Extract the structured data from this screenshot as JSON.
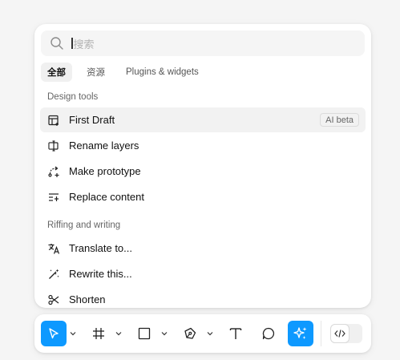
{
  "search": {
    "placeholder": "搜索"
  },
  "tabs": [
    {
      "label": "全部",
      "active": true
    },
    {
      "label": "资源",
      "active": false
    },
    {
      "label": "Plugins & widgets",
      "active": false
    }
  ],
  "sections": [
    {
      "title": "Design tools",
      "items": [
        {
          "label": "First Draft",
          "icon": "layout-icon",
          "badge": "AI beta",
          "selected": true
        },
        {
          "label": "Rename layers",
          "icon": "rename-icon"
        },
        {
          "label": "Make prototype",
          "icon": "prototype-icon"
        },
        {
          "label": "Replace content",
          "icon": "replace-content-icon"
        }
      ]
    },
    {
      "title": "Riffing and writing",
      "items": [
        {
          "label": "Translate to...",
          "icon": "translate-icon"
        },
        {
          "label": "Rewrite this...",
          "icon": "magic-wand-icon"
        },
        {
          "label": "Shorten",
          "icon": "shorten-icon"
        }
      ]
    }
  ],
  "toolbar": {
    "tools": [
      {
        "name": "move-tool",
        "icon": "cursor-icon",
        "active": true
      },
      {
        "name": "frame-tool",
        "icon": "frame-icon"
      },
      {
        "name": "shape-tool",
        "icon": "rectangle-icon"
      },
      {
        "name": "pen-tool",
        "icon": "pen-icon"
      },
      {
        "name": "text-tool",
        "icon": "text-icon"
      },
      {
        "name": "comment-tool",
        "icon": "comment-icon"
      },
      {
        "name": "ai-tool",
        "icon": "sparkle-icon",
        "active": true
      }
    ],
    "dev_mode_icon": "code-icon"
  },
  "colors": {
    "accent": "#0d99ff",
    "panel": "#ffffff",
    "background": "#f5f5f5"
  }
}
